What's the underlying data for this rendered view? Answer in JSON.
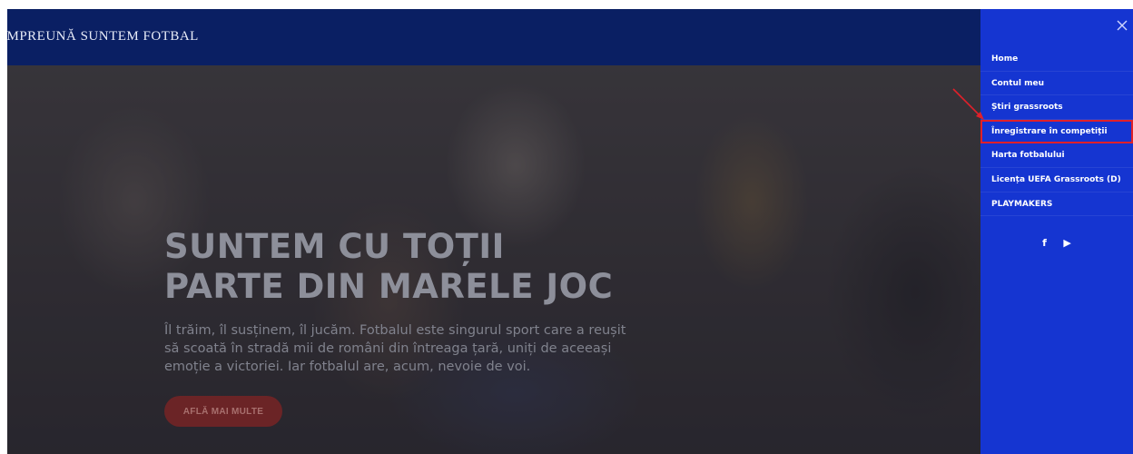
{
  "header": {
    "brand": "ÎMPREUNĂ SUNTEM FOTBAL"
  },
  "hero": {
    "title_line1": "SUNTEM CU TOȚII",
    "title_line2": "PARTE DIN MARELE JOC",
    "paragraph": "Îl trăim, îl susținem, îl jucăm. Fotbalul este singurul sport care a reușit să scoată în stradă mii de români din întreaga țară, uniți de aceeași emoție a victoriei. Iar fotbalul are, acum, nevoie de voi.",
    "cta_label": "AFLĂ MAI MULTE"
  },
  "sidenav": {
    "close_symbol": "×",
    "items": [
      {
        "label": "Home"
      },
      {
        "label": "Contul meu"
      },
      {
        "label": "Știri grassroots"
      },
      {
        "label": "Înregistrare în competiții",
        "highlighted": true
      },
      {
        "label": "Harta fotbalului"
      },
      {
        "label": "Licența UEFA Grassroots (D)"
      },
      {
        "label": "PLAYMAKERS"
      }
    ],
    "socials": [
      {
        "icon": "facebook-icon",
        "glyph": "f"
      },
      {
        "icon": "youtube-icon",
        "glyph": "▶"
      }
    ]
  },
  "colors": {
    "topbar": "#0a1f63",
    "sidenav": "#1535d1",
    "highlight_border": "#e0202a",
    "cta_background": "#6b2426",
    "annotation_arrow": "#e0202a"
  }
}
